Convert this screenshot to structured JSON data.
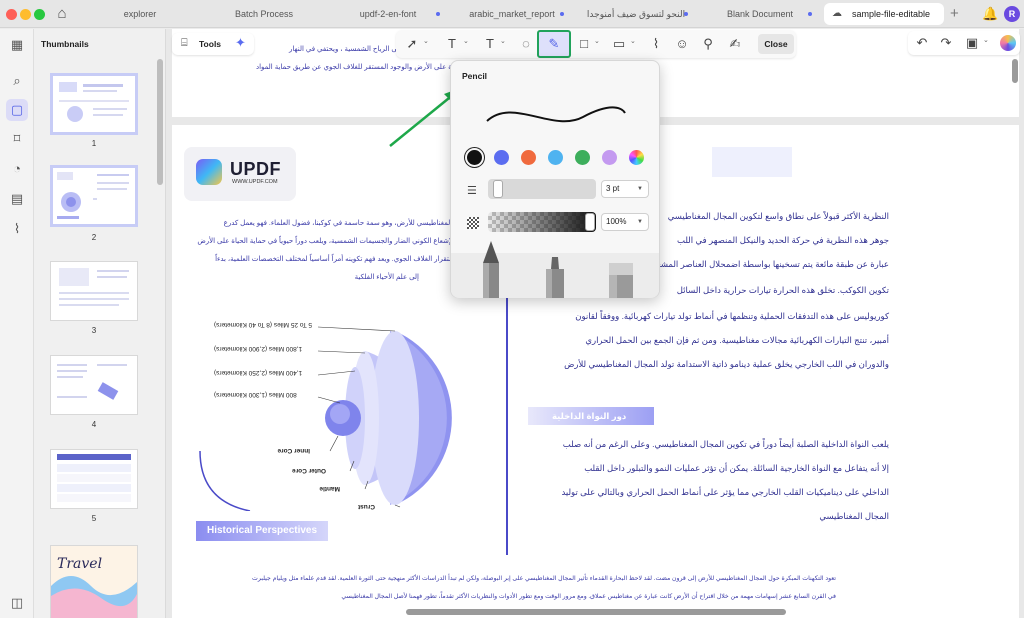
{
  "tabs": [
    {
      "label": "explorer",
      "active": false,
      "dot": false
    },
    {
      "label": "Batch Process",
      "active": false,
      "dot": false
    },
    {
      "label": "updf-2-en-font",
      "active": false,
      "dot": true
    },
    {
      "label": "arabic_market_report",
      "active": false,
      "dot": true
    },
    {
      "label": "النحو لتسوق ضيف أمنوجدا",
      "active": false,
      "dot": true
    },
    {
      "label": "Blank Document",
      "active": false,
      "dot": true
    },
    {
      "label": "sample-file-editable",
      "active": true,
      "dot": false
    }
  ],
  "user_initial": "R",
  "sidebar": {
    "title": "Thumbnails",
    "pages": [
      "1",
      "2",
      "3",
      "4",
      "5"
    ]
  },
  "toolbar": {
    "tools_label": "Tools",
    "close_label": "Close"
  },
  "pencil_popup": {
    "title": "Pencil",
    "colors": [
      "#111111",
      "#5b6df0",
      "#f06a3e",
      "#4fb3f0",
      "#3dae5c",
      "#c49af0",
      "rainbow"
    ],
    "selected_color": "#111111",
    "thickness": "3 pt",
    "opacity": "100%"
  },
  "document": {
    "logo_text": "UPDF",
    "logo_url": "WWW.UPDF.COM",
    "page1_lines": [
      "بالتكويني تعمل يعمل قوى على الرياح الشمسية ، ويحتفي في النهار",
      "على الحياة على الأرض والوجود المستقر للغلاف الجوي عن طريق حماية المواد"
    ],
    "left_para": [
      "يعد المجال المغناطيسي للأرض، وهو سمة حاسمة في كوكبنا، فضول العلماء. فهو يعمل كدرع",
      "وقائي ضد الإشعاع الكوني الضار والجسيمات الشمسية، ويلعب دوراً حيوياً في حماية الحياة على الأرض",
      "ومع ذلك، استقرار الغلاف الجوي. ويعد فهم تكوينه أمراً أساسياً لمختلف التخصصات العلمية، بدءاً",
      "إلى علم الأحياء الفلكية"
    ],
    "diagram_labels": [
      "5 To 25 Miles (8 To 40 Kilometers)",
      "1,800 Miles (2,900 Kilometers)",
      "1,400 Miles (2,250 Kilometers)",
      "800 Miles (1,300 Kilometers)",
      "Inner Core",
      "Outer Core",
      "Mantle",
      "Crust"
    ],
    "right_para": [
      "النظرية الأكثر قبولاً على نطاق واسع لتكوين المجال المغناطيسي",
      "جوهر هذه النظرية في حركة الحديد والنيكل المنصهر في اللب",
      "عبارة عن طبقة مائعة يتم تسخينها بواسطة اضمحلال العناصر المشعة",
      "تكوين الكوكب. تخلق هذه الحرارة تيارات حرارية داخل السائل",
      "كوريوليس على هذه التدفقات الحملية وتنظمها في أنماط تولد تيارات كهربائية. ووفقاً لقانون",
      "أمبير، تنتج التيارات الكهربائية مجالات مغناطيسية. ومن ثم فإن الجمع بين الحمل الحراري",
      "والدوران في اللب الخارجي يخلق عملية دينامو ذاتية الاستدامة تولد المجال المغناطيسي للأرض"
    ],
    "subheading": "دور النواة الداخلية",
    "right_para2": [
      "يلعب النواة الداخلية الصلبة أيضاً دوراً في تكوين المجال المغناطيسي. وعلى الرغم من أنه صلب",
      "إلا أنه يتفاعل مع النواة الخارجية السائلة. يمكن أن تؤثر عمليات النمو والتبلور داخل القلب",
      "الداخلي على ديناميكيات القلب الخارجي مما يؤثر على أنماط الحمل الحراري وبالتالي على توليد",
      "المجال المغناطيسي"
    ],
    "historical_heading": "Historical Perspectives",
    "bottom_para": [
      "تعود التكهنات المبكرة حول المجال المغناطيسي للأرض إلى قرون مضت. لقد لاحظ البحارة القدماء تأثير المجال المغناطيسي على إبر البوصلة، ولكن لم تبدأ الدراسات الأكثر منهجية حتى الثورة العلمية. لقد قدم علماء مثل ويليام جيلبرت",
      "في القرن السابع عشر إسهامات مهمة من خلال اقتراح أن الأرض كانت عبارة عن مغناطيس عملاق. ومع مرور الوقت ومع تطور الأدوات والنظريات الأكثر تقدماً، تطور فهمنا لأصل المجال المغناطيسي"
    ]
  }
}
